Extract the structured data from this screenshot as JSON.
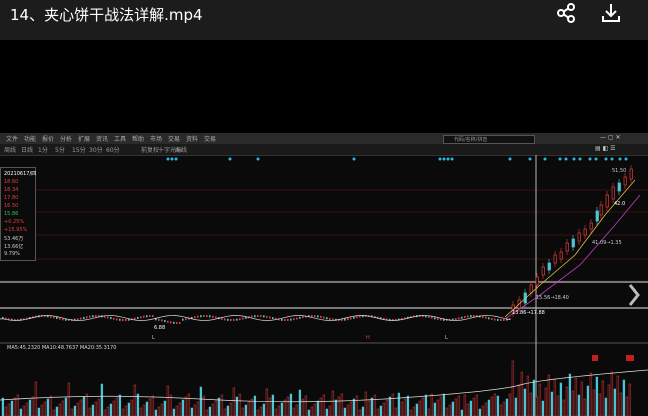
{
  "video": {
    "title": "14、夹心饼干战法详解.mp4"
  },
  "icons": {
    "share": "share-icon",
    "download": "download-icon"
  },
  "menu": [
    "文件",
    "功能",
    "报价",
    "分析",
    "扩展",
    "资讯",
    "工具",
    "帮助",
    "市场",
    "交易",
    "资料",
    "交易"
  ],
  "search_placeholder": "代码/名称/拼音",
  "toolbar": [
    "周线",
    "日线",
    "1分",
    "5分",
    "15分",
    "30分",
    "60分",
    "前复权",
    "十字光标",
    "画线"
  ],
  "info_panel": {
    "date": "20210617/四",
    "rows": [
      {
        "value": "18.60",
        "color": "#e04040"
      },
      {
        "value": "18.34",
        "color": "#e04040"
      },
      {
        "value": "17.80",
        "color": "#e04040"
      },
      {
        "value": "16.50",
        "color": "#e04040"
      },
      {
        "value": "15.86",
        "color": "#30c060"
      },
      {
        "value": "+0.25%",
        "color": "#e04040"
      },
      {
        "value": "+15.95%",
        "color": "#e04040"
      },
      {
        "value": "53.46万",
        "color": "#ccc"
      },
      {
        "value": "13.66亿",
        "color": "#ccc"
      },
      {
        "value": "9.79%",
        "color": "#ccc"
      }
    ]
  },
  "annotations": {
    "peak": "51.50",
    "level": "42.0",
    "mid": "41.09→1.35",
    "lower": "15.56→18.40",
    "cursor": "13.86→17.88",
    "small": "6.88"
  },
  "axis_labels": [
    "L",
    "H",
    "L"
  ],
  "indicator_text": "MA5:45.2320  MA10:48.7637  MA20:35.3170",
  "colors": {
    "up": "#e23b3b",
    "down": "#4cc6d6",
    "ma_white": "#dddddd",
    "ma_yellow": "#e0c040",
    "ma_purple": "#c040c0",
    "dots": "#2ab8e0"
  }
}
